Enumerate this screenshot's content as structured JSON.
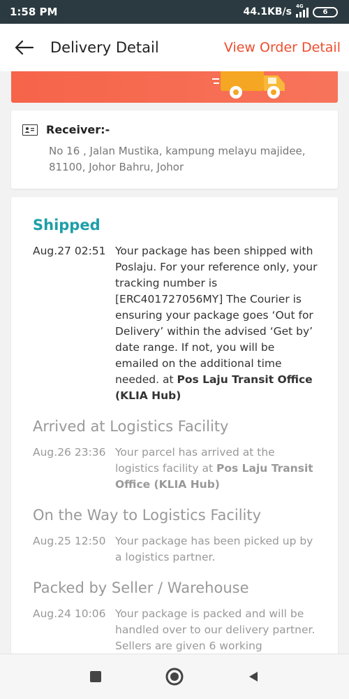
{
  "status_bar": {
    "time": "1:58 PM",
    "network_speed": "44.1KB/s",
    "network_type": "4G",
    "battery": "6"
  },
  "header": {
    "title": "Delivery Detail",
    "view_order": "View Order Detail"
  },
  "receiver": {
    "label": "Receiver:-",
    "address_line1": "No 16 , Jalan Mustika, kampung melayu majidee,",
    "address_line2": "81100, Johor Bahru, Johor"
  },
  "timeline": [
    {
      "status": "Shipped",
      "time": "Aug.27 02:51",
      "text": "Your package has been shipped with Poslaju. For your reference only, your tracking number is [ERC401727056MY] The Courier is ensuring your package goes ‘Out for Delivery’ within the advised ‘Get by’ date range. If not, you will be emailed on the additional time needed. at ",
      "location": "Pos Laju Transit Office (KLIA Hub)"
    },
    {
      "status": "Arrived at Logistics Facility",
      "time": "Aug.26 23:36",
      "text": "Your parcel has arrived at the logistics facility at ",
      "location": "Pos Laju Transit Office (KLIA Hub)"
    },
    {
      "status": "On the Way to Logistics Facility",
      "time": "Aug.25 12:50",
      "text": "Your package has been picked up by a logistics partner.",
      "location": ""
    },
    {
      "status": "Packed by Seller / Warehouse",
      "time": "Aug.24 10:06",
      "text": "Your package is packed and will be handled over to our delivery partner. Sellers are given 6 working",
      "location": ""
    }
  ],
  "colors": {
    "accent": "#ee4d2d",
    "active_status": "#1e9ea8",
    "banner": "#f6644a"
  },
  "icons": {
    "back": "arrow-left-icon",
    "receiver": "id-card-icon",
    "nav": [
      "square-icon",
      "circle-icon",
      "back-triangle-icon"
    ]
  }
}
